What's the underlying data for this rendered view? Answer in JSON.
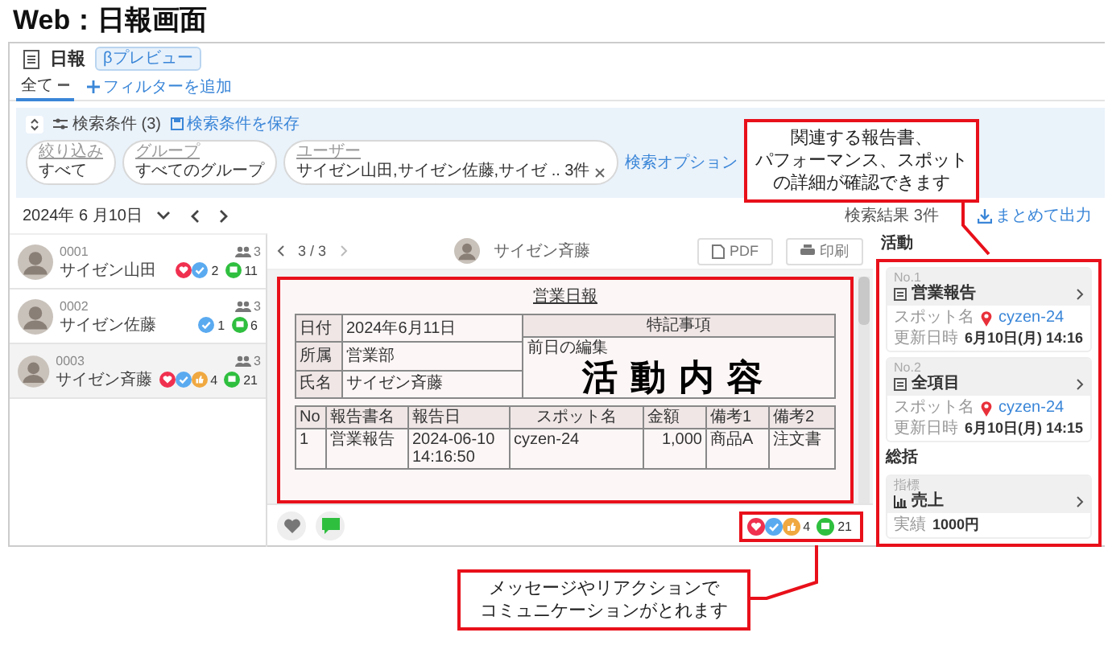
{
  "page_title": "Web：日報画面",
  "app": {
    "title": "日報",
    "badge": "βプレビュー"
  },
  "filter_tabs": [
    {
      "label": "全て",
      "selected": true
    }
  ],
  "add_filter": "フィルターを追加",
  "search": {
    "conditions_label": "検索条件 (3)",
    "save_label": "検索条件を保存",
    "options_label": "検索オプション",
    "fields": [
      {
        "label": "絞り込み",
        "value": "すべて",
        "clearable": false
      },
      {
        "label": "グループ",
        "value": "すべてのグループ",
        "clearable": false
      },
      {
        "label": "ユーザー",
        "value": "サイゼン山田,サイゼン佐藤,サイゼ .. 3件",
        "clearable": true
      }
    ]
  },
  "date": "2024年 6 月10日",
  "result_count": "検索結果 3件",
  "export_label": "まとめて出力",
  "reports": [
    {
      "code": "0001",
      "name": "サイゼン山田",
      "viewers": "3",
      "reactions": [
        {
          "kind": "heart"
        },
        {
          "kind": "check"
        }
      ],
      "reaction_count": "2",
      "comment_count": "11",
      "selected": false
    },
    {
      "code": "0002",
      "name": "サイゼン佐藤",
      "viewers": "3",
      "reactions": [
        {
          "kind": "check"
        }
      ],
      "reaction_count": "1",
      "comment_count": "6",
      "selected": false
    },
    {
      "code": "0003",
      "name": "サイゼン斉藤",
      "viewers": "3",
      "reactions": [
        {
          "kind": "heart"
        },
        {
          "kind": "check"
        },
        {
          "kind": "thumb"
        }
      ],
      "reaction_count": "4",
      "comment_count": "21",
      "selected": true
    }
  ],
  "viewer": {
    "pager": "3 / 3",
    "author": "サイゼン斉藤",
    "pdf_label": "PDF",
    "print_label": "印刷",
    "document": {
      "title": "営業日報",
      "header_rows": [
        {
          "label": "日付",
          "value": "2024年6月11日"
        },
        {
          "label": "所属",
          "value": "営業部"
        },
        {
          "label": "氏名",
          "value": "サイゼン斉藤"
        }
      ],
      "notes_heading": "特記事項",
      "notes_text": "前日の編集",
      "columns": [
        "No",
        "報告書名",
        "報告日",
        "スポット名",
        "金額",
        "備考1",
        "備考2"
      ],
      "rows": [
        [
          "1",
          "営業報告",
          "2024-06-10 14:16:50",
          "cyzen-24",
          "1,000",
          "商品A",
          "注文書"
        ]
      ]
    },
    "reactions": [
      {
        "kind": "heart"
      },
      {
        "kind": "check"
      },
      {
        "kind": "thumb"
      }
    ],
    "reaction_count": "4",
    "comment_count": "21"
  },
  "activities_heading": "活動",
  "activities": [
    {
      "no": "No.1",
      "title": "営業報告",
      "spot_label": "スポット名",
      "spot": "cyzen-24",
      "updated_label": "更新日時",
      "updated": "6月10日(月) 14:16"
    },
    {
      "no": "No.2",
      "title": "全項目",
      "spot_label": "スポット名",
      "spot": "cyzen-24",
      "updated_label": "更新日時",
      "updated": "6月10日(月) 14:15"
    }
  ],
  "summary_heading": "総括",
  "summary": [
    {
      "caption": "指標",
      "title": "売上",
      "result_label": "実績",
      "result": "1000円"
    }
  ],
  "overlay_label": "活動内容",
  "callouts": [
    {
      "lines": [
        "関連する報告書、",
        "パフォーマンス、スポット",
        "の詳細が確認できます"
      ]
    },
    {
      "lines": [
        "メッセージやリアクションで",
        "コミュニケーションがとれます"
      ]
    }
  ]
}
